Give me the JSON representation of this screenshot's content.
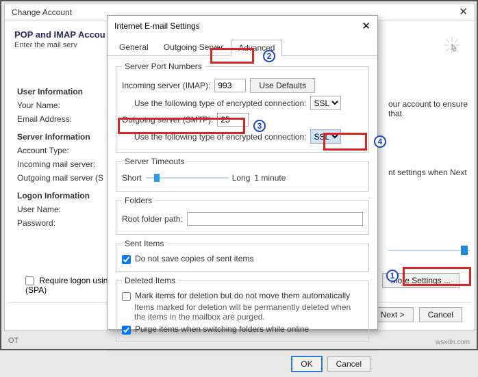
{
  "outer": {
    "title": "Change Account",
    "heading": "POP and IMAP Accou",
    "subhead": "Enter the mail serv",
    "left": {
      "sec1": "User Information",
      "yourname": "Your Name:",
      "email": "Email Address:",
      "sec2": "Server Information",
      "acct_type": "Account Type:",
      "incoming": "Incoming mail server:",
      "outgoing": "Outgoing mail server (S",
      "sec3": "Logon Information",
      "username": "User Name:",
      "password": "Password:"
    },
    "chk_spa": "Require logon using\n(SPA)",
    "right1": "our account to ensure that",
    "right2": "nt settings when Next",
    "more_settings": "More Settings ...",
    "next": "Next >",
    "cancel": "Cancel"
  },
  "inner": {
    "title": "Internet E-mail Settings",
    "tabs": {
      "general": "General",
      "outgoing": "Outgoing Server",
      "advanced": "Advanced"
    },
    "serverports_legend": "Server Port Numbers",
    "incoming_label": "Incoming server (IMAP):",
    "incoming_value": "993",
    "use_defaults": "Use Defaults",
    "encrypt_label": "Use the following type of encrypted connection:",
    "incoming_encrypt": "SSL",
    "outgoing_label": "Outgoing server (SMTP):",
    "outgoing_value": "25",
    "outgoing_encrypt": "SSL",
    "timeouts_legend": "Server Timeouts",
    "short": "Short",
    "long": "Long",
    "minute": "1 minute",
    "folders_legend": "Folders",
    "root_label": "Root folder path:",
    "root_value": "",
    "sent_legend": "Sent Items",
    "sent_chk": "Do not save copies of sent items",
    "deleted_legend": "Deleted Items",
    "del_chk1": "Mark items for deletion but do not move them automatically",
    "del_note": "Items marked for deletion will be permanently deleted when the items in the mailbox are purged.",
    "del_chk2": "Purge items when switching folders while online",
    "ok": "OK",
    "cancel": "Cancel"
  },
  "annotations": {
    "n1": "1",
    "n2": "2",
    "n3": "3",
    "n4": "4"
  },
  "footer": {
    "brand": "wsxdn.com",
    "ot": "OT"
  }
}
